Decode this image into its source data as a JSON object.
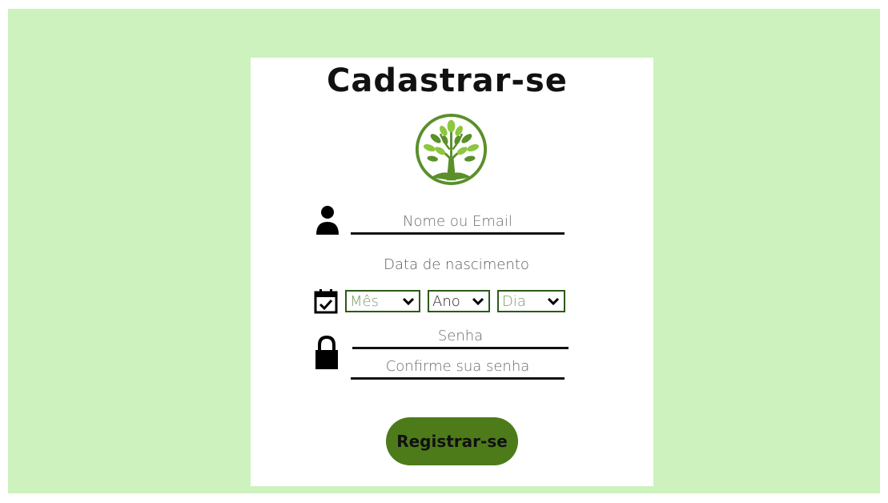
{
  "page": {
    "title": "Cadastrar-se",
    "logo_icon": "tree-icon"
  },
  "form": {
    "name_placeholder": "Nome ou Email",
    "dob_label": "Data de nascimento",
    "month_value": "Mês",
    "year_value": "Ano",
    "day_value": "Dia",
    "password_placeholder": "Senha",
    "confirm_password_placeholder": "Confirme sua senha",
    "register_label": "Registrar-se"
  },
  "icons": {
    "user": "user-icon",
    "calendar": "calendar-check-icon",
    "lock": "lock-icon",
    "chevron": "chevron-down-icon"
  },
  "colors": {
    "background": "#cdf2bd",
    "card": "#ffffff",
    "accent": "#4d7b1a",
    "text": "#111111"
  }
}
